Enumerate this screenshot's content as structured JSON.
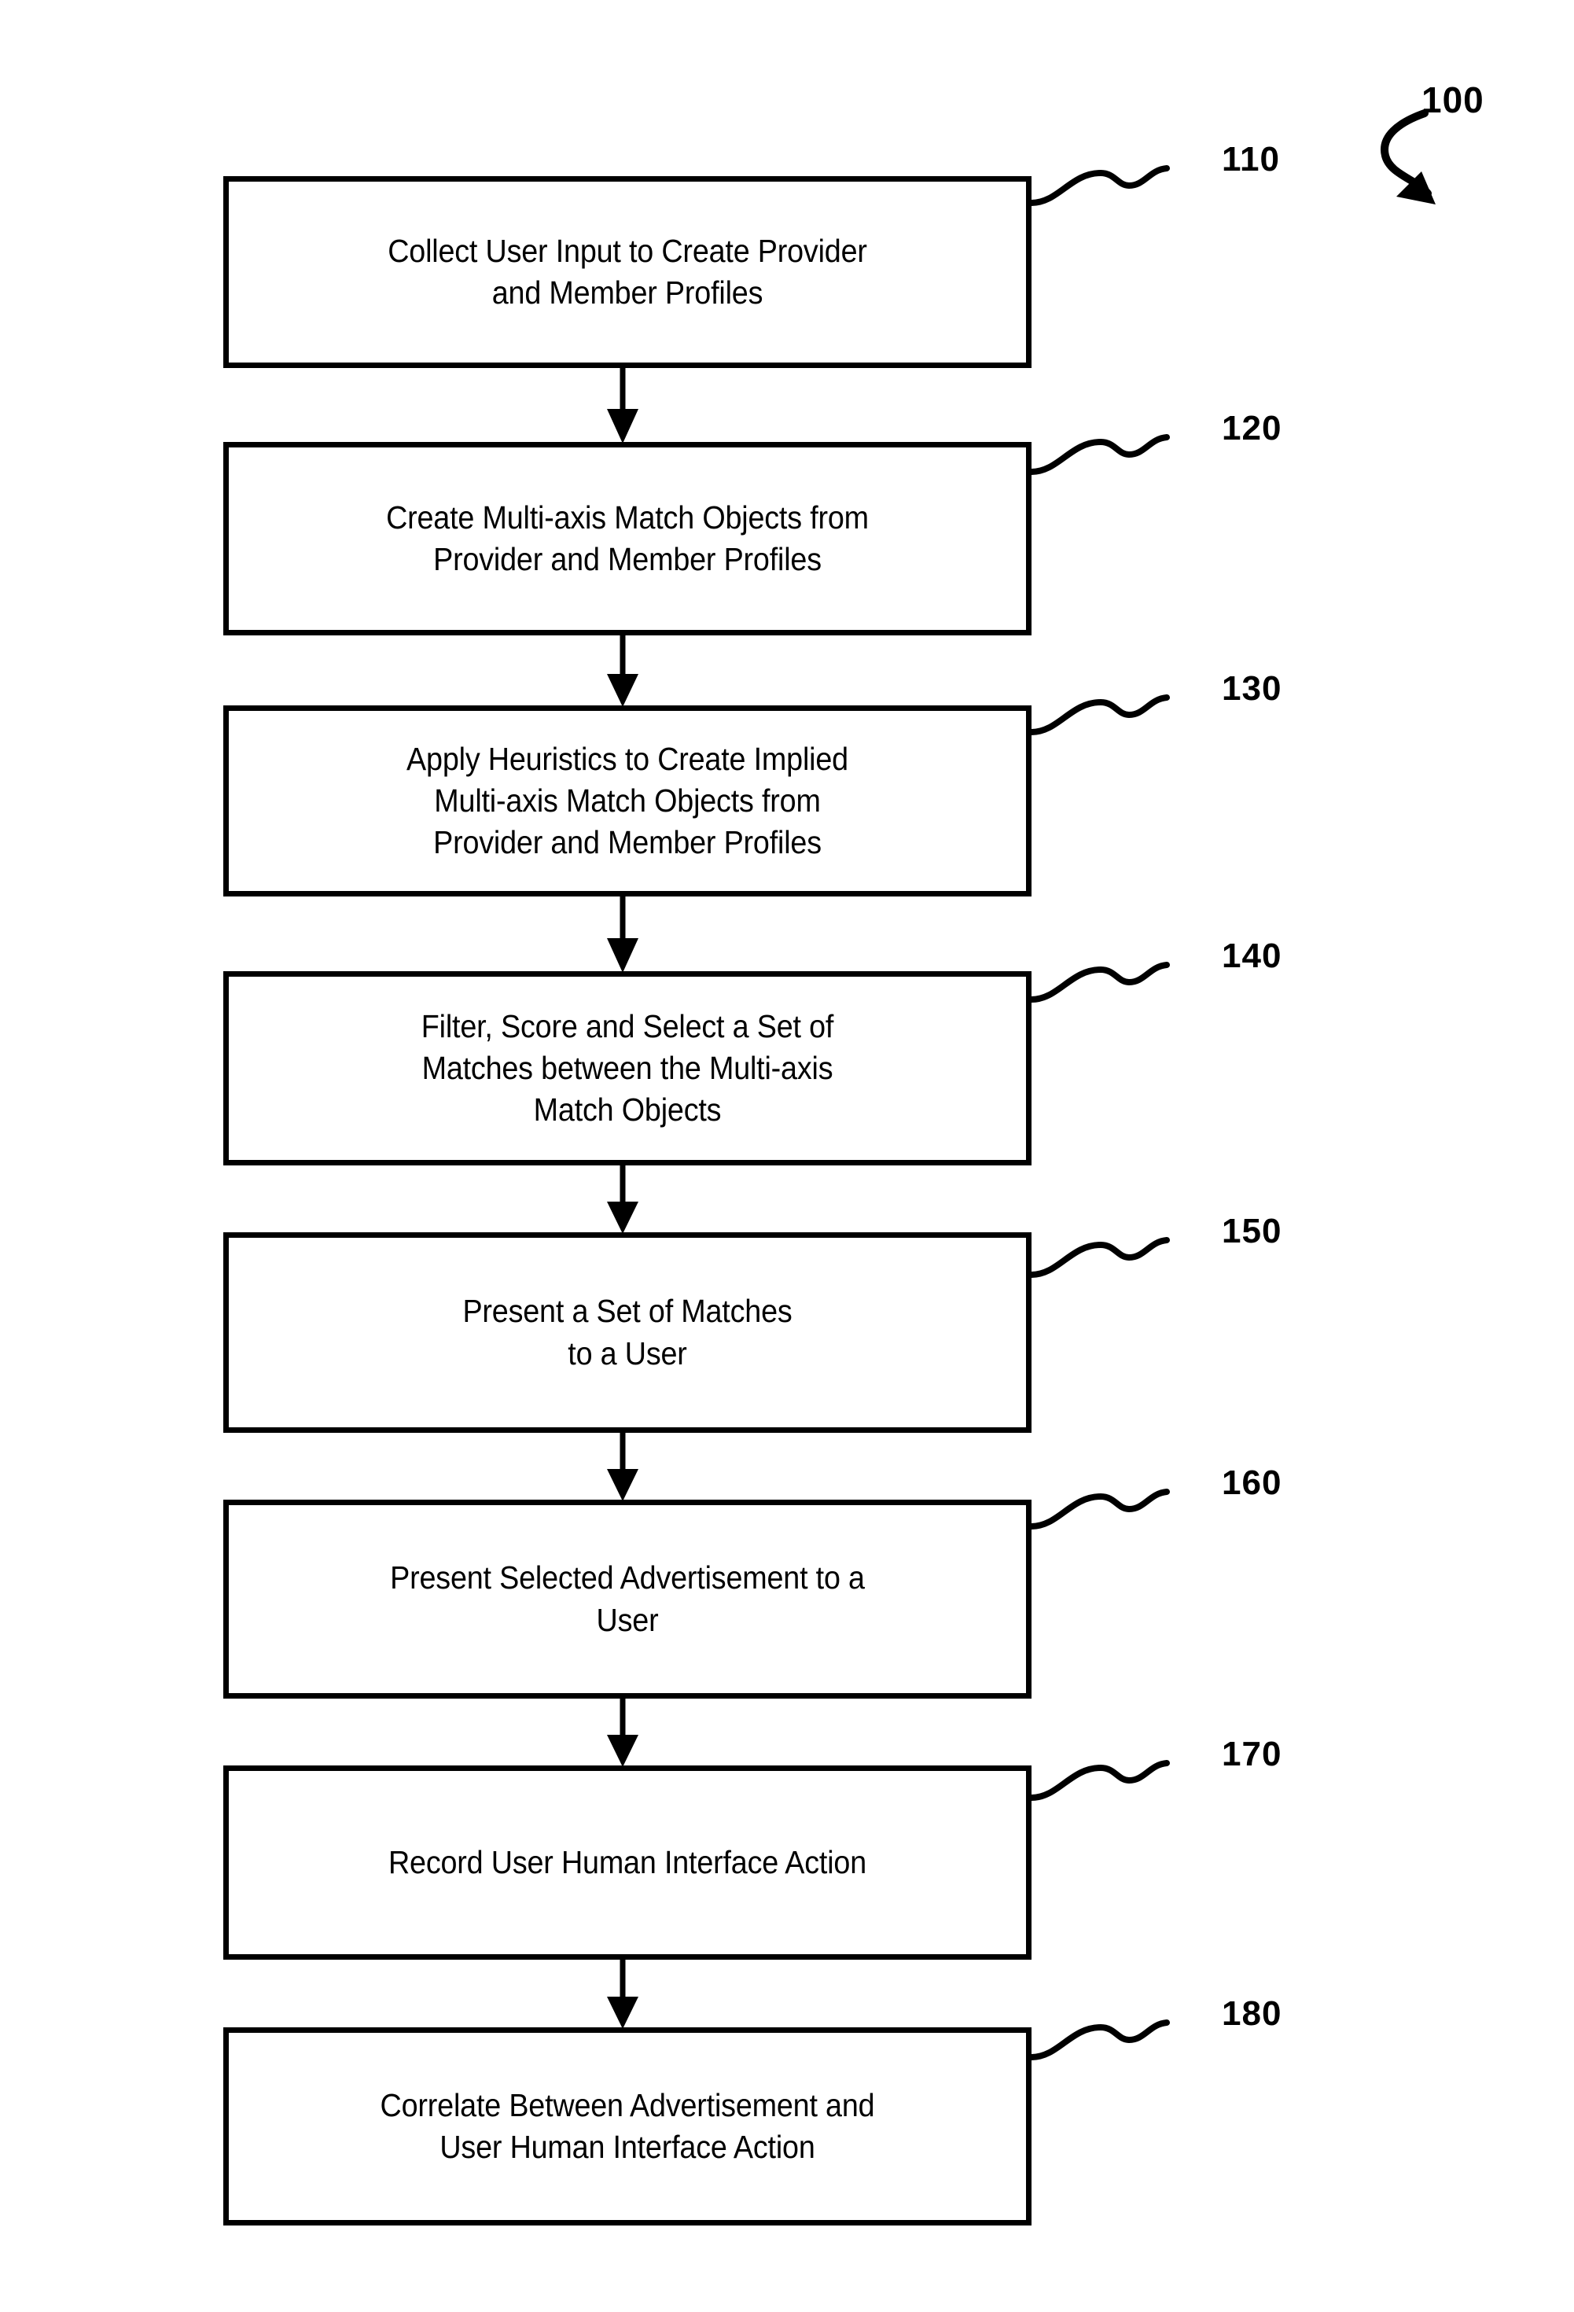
{
  "figure": {
    "figure_number": "100",
    "boxes": [
      {
        "ref": "110",
        "text": "Collect User Input to Create Provider\nand Member Profiles"
      },
      {
        "ref": "120",
        "text": "Create Multi-axis Match Objects from\nProvider and Member Profiles"
      },
      {
        "ref": "130",
        "text": "Apply Heuristics to Create Implied\nMulti-axis Match Objects from\nProvider and Member Profiles"
      },
      {
        "ref": "140",
        "text": "Filter, Score and Select a Set of\nMatches between the Multi-axis\nMatch Objects"
      },
      {
        "ref": "150",
        "text": "Present a Set of Matches\nto a User"
      },
      {
        "ref": "160",
        "text": "Present Selected Advertisement to a\nUser"
      },
      {
        "ref": "170",
        "text": "Record User Human Interface Action"
      },
      {
        "ref": "180",
        "text": "Correlate Between Advertisement and\nUser Human Interface Action"
      }
    ]
  },
  "colors": {
    "stroke": "#000000",
    "fill": "#ffffff"
  }
}
